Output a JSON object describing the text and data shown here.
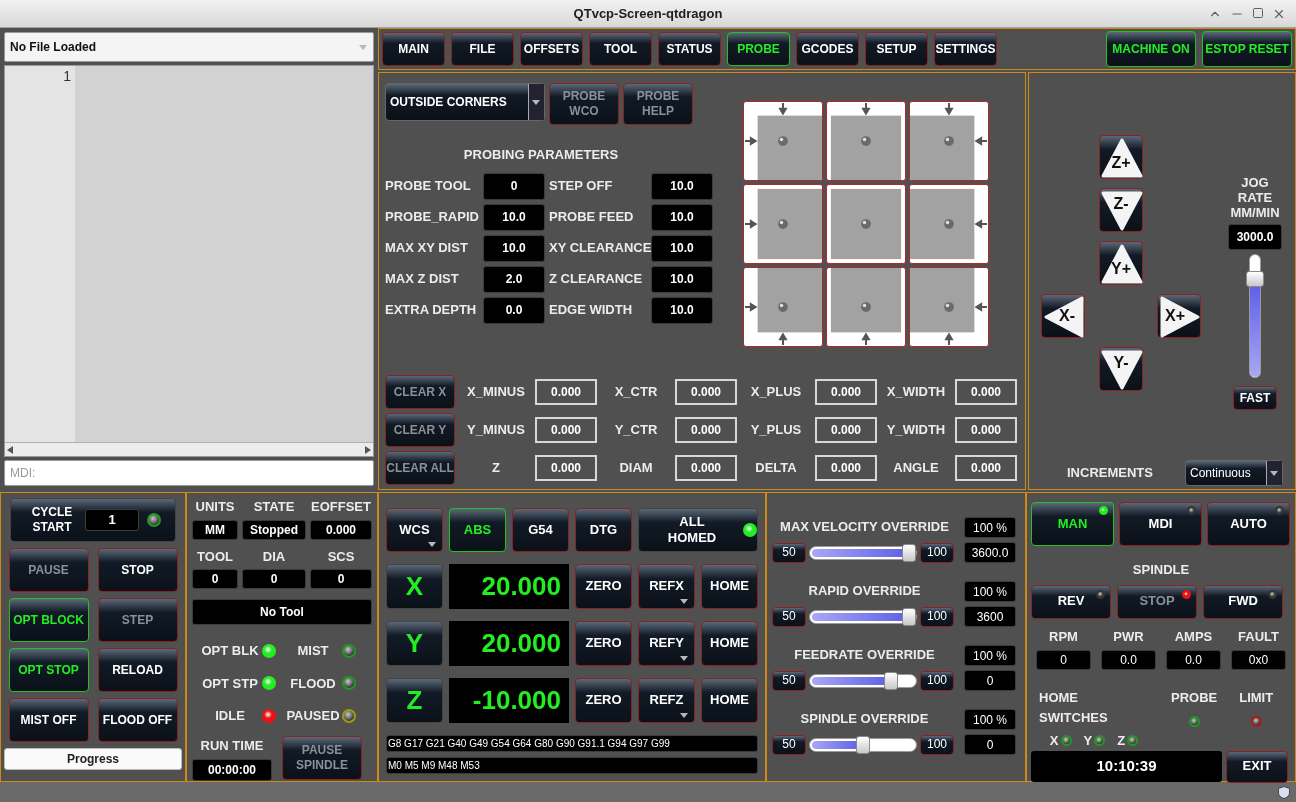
{
  "window": {
    "title": "QTvcp-Screen-qtdragon"
  },
  "file_panel": {
    "file": "No File Loaded",
    "line_numbers": [
      "1"
    ],
    "mdi": {
      "placeholder": "MDI:"
    }
  },
  "tabs": [
    {
      "label": "MAIN",
      "selected": false
    },
    {
      "label": "FILE",
      "selected": false
    },
    {
      "label": "OFFSETS",
      "selected": false
    },
    {
      "label": "TOOL",
      "selected": false
    },
    {
      "label": "STATUS",
      "selected": false
    },
    {
      "label": "PROBE",
      "selected": true
    },
    {
      "label": "GCODES",
      "selected": false
    },
    {
      "label": "SETUP",
      "selected": false
    },
    {
      "label": "SETTINGS",
      "selected": false
    }
  ],
  "machine_buttons": [
    {
      "label": "MACHINE ON",
      "active": true
    },
    {
      "label": "ESTOP RESET",
      "active": true
    }
  ],
  "probe": {
    "mode": "OUTSIDE CORNERS",
    "buttons": [
      {
        "label": "PROBE WCO",
        "disabled": true
      },
      {
        "label": "PROBE HELP",
        "disabled": true
      }
    ],
    "params_title": "PROBING PARAMETERS",
    "params": [
      {
        "label": "PROBE TOOL",
        "value": "0"
      },
      {
        "label": "STEP OFF",
        "value": "10.0"
      },
      {
        "label": "PROBE_RAPID",
        "value": "10.0"
      },
      {
        "label": "PROBE FEED",
        "value": "10.0"
      },
      {
        "label": "MAX XY DIST",
        "value": "10.0"
      },
      {
        "label": "XY CLEARANCE",
        "value": "10.0"
      },
      {
        "label": "MAX Z DIST",
        "value": "2.0"
      },
      {
        "label": "Z CLEARANCE",
        "value": "10.0"
      },
      {
        "label": "EXTRA DEPTH",
        "value": "0.0"
      },
      {
        "label": "EDGE WIDTH",
        "value": "10.0"
      }
    ],
    "results": [
      {
        "button": {
          "label": "CLEAR X",
          "disabled": true
        },
        "cells": [
          {
            "label": "X_MINUS",
            "value": "0.000"
          },
          {
            "label": "X_CTR",
            "value": "0.000"
          },
          {
            "label": "X_PLUS",
            "value": "0.000"
          },
          {
            "label": "X_WIDTH",
            "value": "0.000"
          }
        ]
      },
      {
        "button": {
          "label": "CLEAR Y",
          "disabled": true
        },
        "cells": [
          {
            "label": "Y_MINUS",
            "value": "0.000"
          },
          {
            "label": "Y_CTR",
            "value": "0.000"
          },
          {
            "label": "Y_PLUS",
            "value": "0.000"
          },
          {
            "label": "Y_WIDTH",
            "value": "0.000"
          }
        ]
      },
      {
        "button": {
          "label": "CLEAR ALL",
          "disabled": true
        },
        "cells": [
          {
            "label": "Z",
            "value": "0.000"
          },
          {
            "label": "DIAM",
            "value": "0.000"
          },
          {
            "label": "DELTA",
            "value": "0.000"
          },
          {
            "label": "ANGLE",
            "value": "0.000"
          }
        ]
      }
    ]
  },
  "jog": {
    "buttons": [
      {
        "label": "Z+",
        "kind": "up"
      },
      {
        "label": "Z-",
        "kind": "down"
      },
      {
        "label": "Y+",
        "kind": "up"
      },
      {
        "label": "X-",
        "kind": "left"
      },
      {
        "label": "X+",
        "kind": "right"
      },
      {
        "label": "Y-",
        "kind": "down"
      }
    ],
    "rate_title": "JOG RATE MM/MIN",
    "rate": "3000.0",
    "level": 0.8,
    "fast": "FAST",
    "increments_label": "INCREMENTS",
    "increments": "Continuous"
  },
  "cycle": {
    "start": "CYCLE START",
    "count": "1",
    "led": {
      "on": false,
      "color": "#1e9a1e"
    },
    "buttons": [
      {
        "label": "PAUSE",
        "active": false,
        "disabled": true
      },
      {
        "label": "STOP",
        "active": false,
        "disabled": false
      },
      {
        "label": "OPT BLOCK",
        "active": true,
        "disabled": false
      },
      {
        "label": "STEP",
        "active": false,
        "disabled": true
      },
      {
        "label": "OPT STOP",
        "active": true,
        "disabled": false
      },
      {
        "label": "RELOAD",
        "active": false,
        "disabled": false
      },
      {
        "label": "MIST OFF",
        "active": false,
        "disabled": false
      },
      {
        "label": "FLOOD OFF",
        "active": false,
        "disabled": false
      }
    ],
    "progress": {
      "label": "Progress",
      "level": 0
    }
  },
  "status": {
    "fields": [
      {
        "label": "UNITS",
        "value": "MM"
      },
      {
        "label": "STATE",
        "value": "Stopped"
      },
      {
        "label": "EOFFSET",
        "value": "0.000"
      },
      {
        "label": "TOOL",
        "value": "0"
      },
      {
        "label": "DIA",
        "value": "0"
      },
      {
        "label": "SCS",
        "value": "0"
      }
    ],
    "tool": "No Tool",
    "indicators": [
      {
        "label": "OPT BLK",
        "on": true,
        "color": "#22ee22"
      },
      {
        "label": "MIST",
        "on": false,
        "color": "#1e9a1e"
      },
      {
        "label": "OPT STP",
        "on": true,
        "color": "#22ee22"
      },
      {
        "label": "FLOOD",
        "on": false,
        "color": "#1e9a1e"
      },
      {
        "label": "IDLE",
        "on": true,
        "color": "#ee1111"
      },
      {
        "label": "PAUSED",
        "on": false,
        "color": "#a09a10"
      }
    ],
    "run_time_label": "RUN TIME",
    "run_time": "00:00:00",
    "pause_spindle": {
      "label": "PAUSE SPINDLE",
      "disabled": true
    }
  },
  "dro": {
    "modes": [
      {
        "label": "WCS",
        "active": false,
        "menu": true
      },
      {
        "label": "ABS",
        "active": true,
        "menu": false
      },
      {
        "label": "G54",
        "active": false,
        "menu": false
      },
      {
        "label": "DTG",
        "active": false,
        "menu": false
      }
    ],
    "all_homed": {
      "label": "ALL HOMED",
      "led": {
        "on": true,
        "color": "#22ee22"
      }
    },
    "axes": [
      {
        "axis": "X",
        "value": "20.000",
        "buttons": [
          {
            "label": "ZERO",
            "menu": false
          },
          {
            "label": "REFX",
            "menu": true
          },
          {
            "label": "HOME",
            "menu": false
          }
        ]
      },
      {
        "axis": "Y",
        "value": "20.000",
        "buttons": [
          {
            "label": "ZERO",
            "menu": false
          },
          {
            "label": "REFY",
            "menu": true
          },
          {
            "label": "HOME",
            "menu": false
          }
        ]
      },
      {
        "axis": "Z",
        "value": "-10.000",
        "buttons": [
          {
            "label": "ZERO",
            "menu": false
          },
          {
            "label": "REFZ",
            "menu": true
          },
          {
            "label": "HOME",
            "menu": false
          }
        ]
      }
    ],
    "gcodes": "G8 G17 G21 G40 G49 G54 G64 G80 G90 G91.1 G94 G97 G99",
    "mcodes": "M0 M5 M9 M48 M53"
  },
  "overrides": [
    {
      "title": "MAX VELOCITY OVERRIDE",
      "min": "50",
      "max": "100",
      "level": 1,
      "percent": "100 %",
      "reading": "3600.0"
    },
    {
      "title": "RAPID OVERRIDE",
      "min": "50",
      "max": "100",
      "level": 1,
      "percent": "100 %",
      "reading": "3600"
    },
    {
      "title": "FEEDRATE OVERRIDE",
      "min": "50",
      "max": "100",
      "level": 0.8,
      "percent": "100 %",
      "reading": "0"
    },
    {
      "title": "SPINDLE OVERRIDE",
      "min": "50",
      "max": "100",
      "level": 0.5,
      "percent": "100 %",
      "reading": "0"
    }
  ],
  "modes": [
    {
      "label": "MAN",
      "selected": true,
      "led": {
        "on": true,
        "color": "#22ee22"
      }
    },
    {
      "label": "MDI",
      "selected": false,
      "led": {
        "on": false,
        "color": "#333333"
      }
    },
    {
      "label": "AUTO",
      "selected": false,
      "led": {
        "on": false,
        "color": "#333333"
      }
    }
  ],
  "spindle": {
    "title": "SPINDLE",
    "buttons": [
      {
        "label": "REV",
        "disabled": false,
        "led": {
          "on": false,
          "color": "#333333"
        }
      },
      {
        "label": "STOP",
        "disabled": true,
        "led": {
          "on": true,
          "color": "#ee1111"
        }
      },
      {
        "label": "FWD",
        "disabled": false,
        "led": {
          "on": false,
          "color": "#333333"
        }
      }
    ],
    "readouts": [
      {
        "label": "RPM",
        "value": "0"
      },
      {
        "label": "PWR",
        "value": "0.0"
      },
      {
        "label": "AMPS",
        "value": "0.0"
      },
      {
        "label": "FAULT",
        "value": "0x0"
      }
    ]
  },
  "switches": {
    "title": "HOME SWITCHES",
    "axes": [
      {
        "label": "X",
        "on": false,
        "color": "#1e9a1e"
      },
      {
        "label": "Y",
        "on": false,
        "color": "#1e9a1e"
      },
      {
        "label": "Z",
        "on": false,
        "color": "#1e9a1e"
      }
    ],
    "probe": {
      "label": "PROBE",
      "on": false,
      "color": "#1e9a1e"
    },
    "limit": {
      "label": "LIMIT",
      "on": false,
      "color": "#b01a1a"
    }
  },
  "clock": "10:10:39",
  "exit": "EXIT"
}
